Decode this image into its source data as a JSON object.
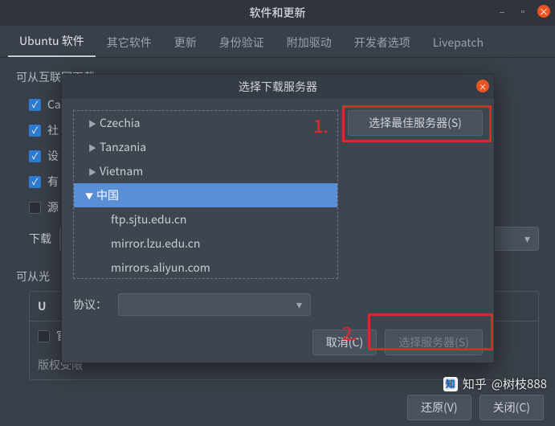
{
  "main": {
    "title": "软件和更新",
    "tabs": [
      {
        "label": "Ubuntu 软件",
        "active": true
      },
      {
        "label": "其它软件"
      },
      {
        "label": "更新"
      },
      {
        "label": "身份验证"
      },
      {
        "label": "附加驱动"
      },
      {
        "label": "开发者选项"
      },
      {
        "label": "Livepatch"
      }
    ],
    "section1": "可从互联网下载",
    "checks": [
      {
        "label": "Ca",
        "checked": true
      },
      {
        "label": "社",
        "checked": true
      },
      {
        "label": "设",
        "checked": true
      },
      {
        "label": "有",
        "checked": true
      },
      {
        "label": "源",
        "checked": false
      }
    ],
    "download_label": "下载",
    "section2": "可从光",
    "group_head": "U",
    "group_row1": "官方支持",
    "group_row2": "版权受限"
  },
  "dialog": {
    "title": "选择下载服务器",
    "tree": {
      "countries": [
        "Czechia",
        "Tanzania",
        "Vietnam"
      ],
      "selected": "中国",
      "mirrors": [
        "ftp.sjtu.edu.cn",
        "mirror.lzu.edu.cn",
        "mirrors.aliyun.com"
      ]
    },
    "best_button": "选择最佳服务器(S)",
    "protocol_label": "协议：",
    "cancel": "取消(C)",
    "choose": "选择服务器(S)"
  },
  "annotations": {
    "num1": "1.",
    "num2": "2."
  },
  "footer": {
    "revert": "还原(V)",
    "close": "关闭(C)"
  },
  "watermark": {
    "brand": "知乎",
    "user": "@树枝888",
    "icon": "知"
  }
}
